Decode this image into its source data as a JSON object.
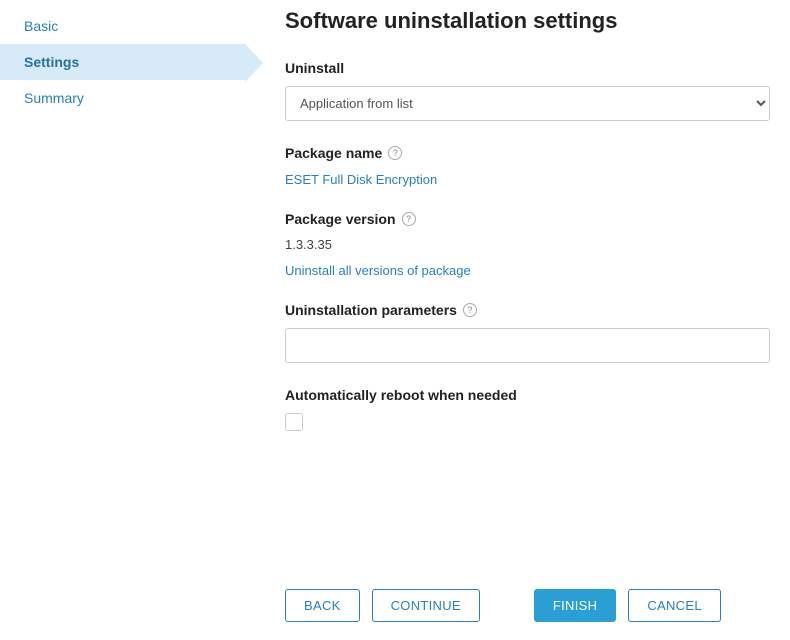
{
  "sidebar": {
    "items": [
      {
        "label": "Basic"
      },
      {
        "label": "Settings"
      },
      {
        "label": "Summary"
      }
    ]
  },
  "page": {
    "title": "Software uninstallation settings"
  },
  "fields": {
    "uninstall": {
      "label": "Uninstall",
      "value": "Application from list"
    },
    "package_name": {
      "label": "Package name",
      "value": "ESET Full Disk Encryption"
    },
    "package_version": {
      "label": "Package version",
      "value": "1.3.3.35",
      "link": "Uninstall all versions of package"
    },
    "uninstall_params": {
      "label": "Uninstallation parameters",
      "value": ""
    },
    "auto_reboot": {
      "label": "Automatically reboot when needed",
      "checked": false
    }
  },
  "footer": {
    "back": "BACK",
    "continue": "CONTINUE",
    "finish": "FINISH",
    "cancel": "CANCEL"
  }
}
